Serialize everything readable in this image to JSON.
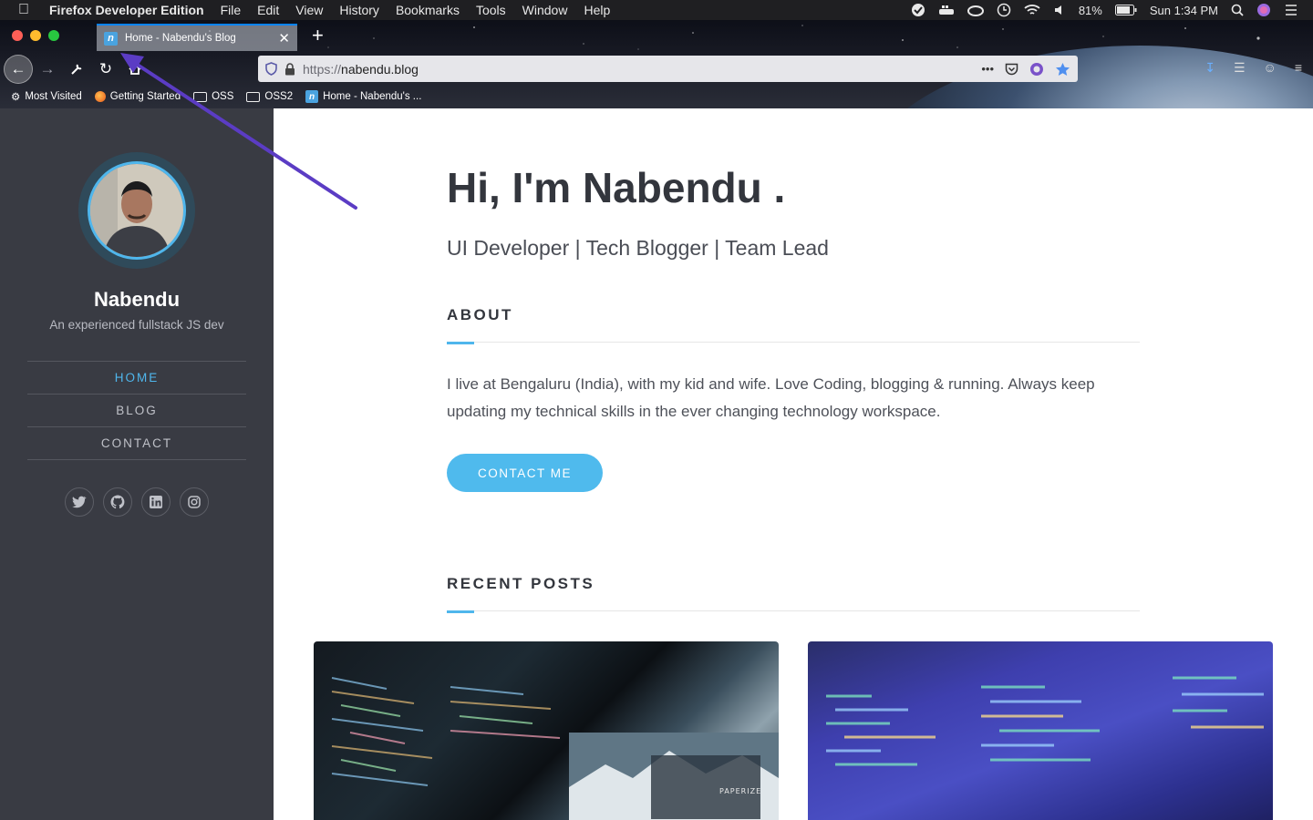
{
  "menubar": {
    "app_name": "Firefox Developer Edition",
    "items": [
      "File",
      "Edit",
      "View",
      "History",
      "Bookmarks",
      "Tools",
      "Window",
      "Help"
    ],
    "battery": "81%",
    "clock": "Sun 1:34 PM"
  },
  "browser": {
    "tab_title": "Home - Nabendu's Blog",
    "url_protocol": "https://",
    "url_host": "nabendu.blog",
    "bookmarks": [
      {
        "label": "Most Visited",
        "icon": "gear-icon"
      },
      {
        "label": "Getting Started",
        "icon": "firefox-icon"
      },
      {
        "label": "OSS",
        "icon": "folder-icon"
      },
      {
        "label": "OSS2",
        "icon": "folder-icon"
      },
      {
        "label": "Home - Nabendu's ...",
        "icon": "site-favicon"
      }
    ]
  },
  "sidebar": {
    "name": "Nabendu",
    "tagline": "An experienced fullstack JS dev",
    "nav": [
      "HOME",
      "BLOG",
      "CONTACT"
    ],
    "social": [
      "twitter-icon",
      "github-icon",
      "linkedin-icon",
      "instagram-icon"
    ]
  },
  "main": {
    "hero_title": "Hi, I'm Nabendu .",
    "hero_subtitle": "UI Developer | Tech Blogger | Team Lead",
    "about_heading": "ABOUT",
    "about_text": "I live at Bengaluru (India), with my kid and wife. Love Coding, blogging & running. Always keep updating my technical skills in the ever changing technology workspace.",
    "contact_button": "CONTACT ME",
    "recent_heading": "RECENT POSTS",
    "post1_caption": "PAPERIZE"
  },
  "colors": {
    "accent": "#4fb6ec",
    "sidebar_bg": "#393b43",
    "annotation_arrow": "#5b3cc4"
  }
}
